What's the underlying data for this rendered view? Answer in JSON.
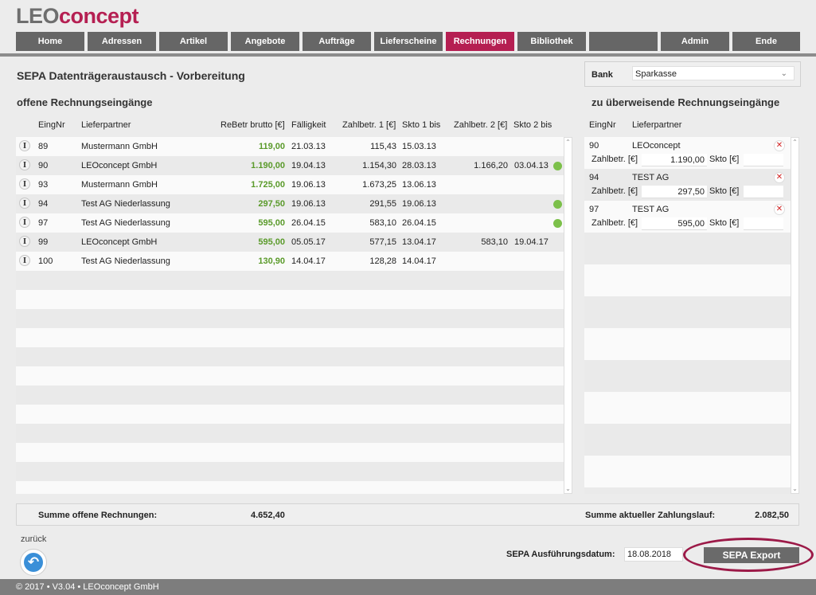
{
  "logo": {
    "part1": "LEO",
    "part2": "concept"
  },
  "nav": {
    "tabs": [
      {
        "label": "Home",
        "active": false
      },
      {
        "label": "Adressen",
        "active": false
      },
      {
        "label": "Artikel",
        "active": false
      },
      {
        "label": "Angebote",
        "active": false
      },
      {
        "label": "Aufträge",
        "active": false
      },
      {
        "label": "Lieferscheine",
        "active": false
      },
      {
        "label": "Rechnungen",
        "active": true
      },
      {
        "label": "Bibliothek",
        "active": false
      },
      {
        "label": "",
        "active": false
      },
      {
        "label": "Admin",
        "active": false
      },
      {
        "label": "Ende",
        "active": false
      }
    ]
  },
  "page": {
    "title": "SEPA Datenträgeraustausch - Vorbereitung"
  },
  "bank": {
    "label": "Bank",
    "value": "Sparkasse"
  },
  "left": {
    "title": "offene Rechnungseingänge",
    "headers": {
      "nr": "EingNr",
      "partner": "Lieferpartner",
      "brutto": "ReBetr brutto [€]",
      "due": "Fälligkeit",
      "z1": "Zahlbetr. 1 [€]",
      "s1": "Skto 1 bis",
      "z2": "Zahlbetr. 2 [€]",
      "s2": "Skto 2 bis"
    },
    "info_glyph": "I",
    "rows": [
      {
        "nr": "89",
        "partner": "Mustermann GmbH",
        "brutto": "119,00",
        "due": "21.03.13",
        "z1": "115,43",
        "s1": "15.03.13",
        "z2": "",
        "s2": "",
        "dot": false
      },
      {
        "nr": "90",
        "partner": "LEOconcept GmbH",
        "brutto": "1.190,00",
        "due": "19.04.13",
        "z1": "1.154,30",
        "s1": "28.03.13",
        "z2": "1.166,20",
        "s2": "03.04.13",
        "dot": true
      },
      {
        "nr": "93",
        "partner": "Mustermann GmbH",
        "brutto": "1.725,00",
        "due": "19.06.13",
        "z1": "1.673,25",
        "s1": "13.06.13",
        "z2": "",
        "s2": "",
        "dot": false
      },
      {
        "nr": "94",
        "partner": "Test AG Niederlassung",
        "brutto": "297,50",
        "due": "19.06.13",
        "z1": "291,55",
        "s1": "19.06.13",
        "z2": "",
        "s2": "",
        "dot": true
      },
      {
        "nr": "97",
        "partner": "Test AG Niederlassung",
        "brutto": "595,00",
        "due": "26.04.15",
        "z1": "583,10",
        "s1": "26.04.15",
        "z2": "",
        "s2": "",
        "dot": true
      },
      {
        "nr": "99",
        "partner": "LEOconcept GmbH",
        "brutto": "595,00",
        "due": "05.05.17",
        "z1": "577,15",
        "s1": "13.04.17",
        "z2": "583,10",
        "s2": "19.04.17",
        "dot": false
      },
      {
        "nr": "100",
        "partner": "Test AG Niederlassung",
        "brutto": "130,90",
        "due": "14.04.17",
        "z1": "128,28",
        "s1": "14.04.17",
        "z2": "",
        "s2": "",
        "dot": false
      }
    ],
    "sum_label": "Summe offene Rechnungen:",
    "sum_value": "4.652,40"
  },
  "right": {
    "title": "zu überweisende Rechnungseingänge",
    "headers": {
      "nr": "EingNr",
      "partner": "Lieferpartner"
    },
    "field_label": "Zahlbetr. [€]",
    "skto_label": "Skto [€]",
    "remove_glyph": "✕",
    "items": [
      {
        "nr": "90",
        "partner": "LEOconcept",
        "amount": "1.190,00",
        "skto": ""
      },
      {
        "nr": "94",
        "partner": "TEST AG",
        "amount": "297,50",
        "skto": ""
      },
      {
        "nr": "97",
        "partner": "TEST AG",
        "amount": "595,00",
        "skto": ""
      }
    ],
    "sum_label": "Summe aktueller Zahlungslauf:",
    "sum_value": "2.082,50"
  },
  "bottom": {
    "back_label": "zurück",
    "date_label": "SEPA Ausführungsdatum:",
    "date_value": "18.08.2018",
    "export_label": "SEPA Export"
  },
  "footer": {
    "text": "© 2017 • V3.04 • LEOconcept GmbH"
  },
  "colors": {
    "accent": "#b51f52",
    "tab": "#666666",
    "green": "#5a9a2a",
    "dot": "#7cc04a"
  }
}
